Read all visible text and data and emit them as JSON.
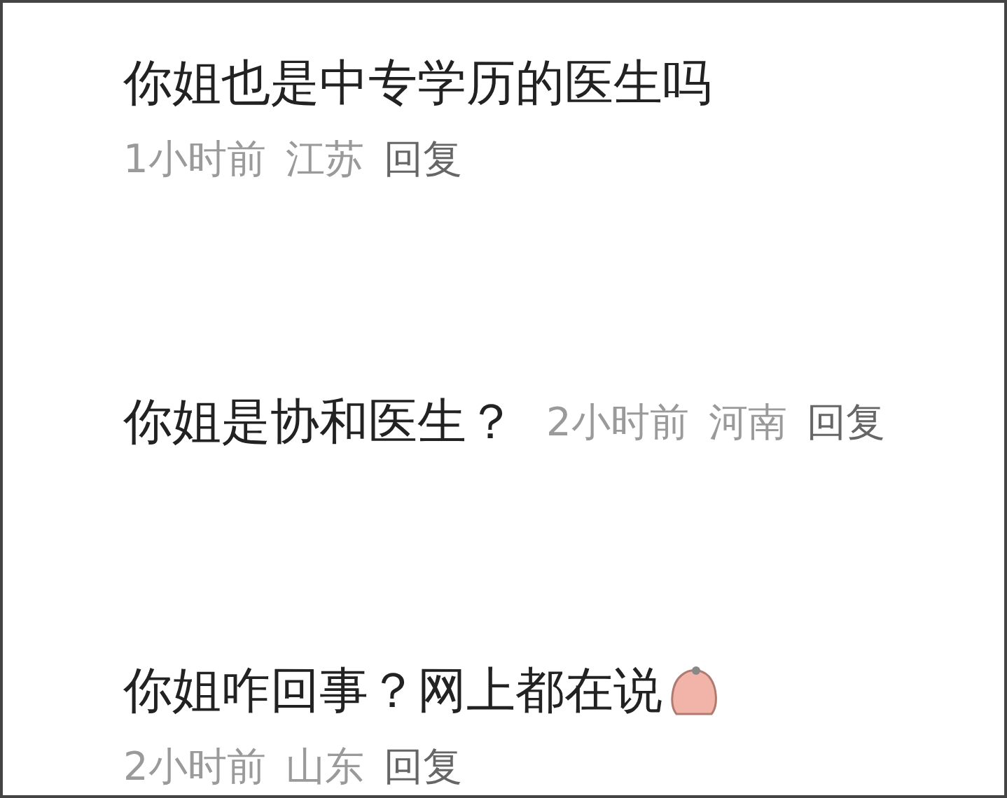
{
  "comments": [
    {
      "kind": "stacked",
      "text": "你姐也是中专学历的医生吗",
      "sticker": false,
      "time": "1小时前",
      "location": "江苏",
      "reply": "回复"
    },
    {
      "kind": "inline",
      "text": "你姐是协和医生？",
      "sticker": false,
      "time": "2小时前",
      "location": "河南",
      "reply": "回复"
    },
    {
      "kind": "stacked",
      "text": "你姐咋回事？网上都在说",
      "sticker": true,
      "time": "2小时前",
      "location": "山东",
      "reply": "回复"
    }
  ]
}
